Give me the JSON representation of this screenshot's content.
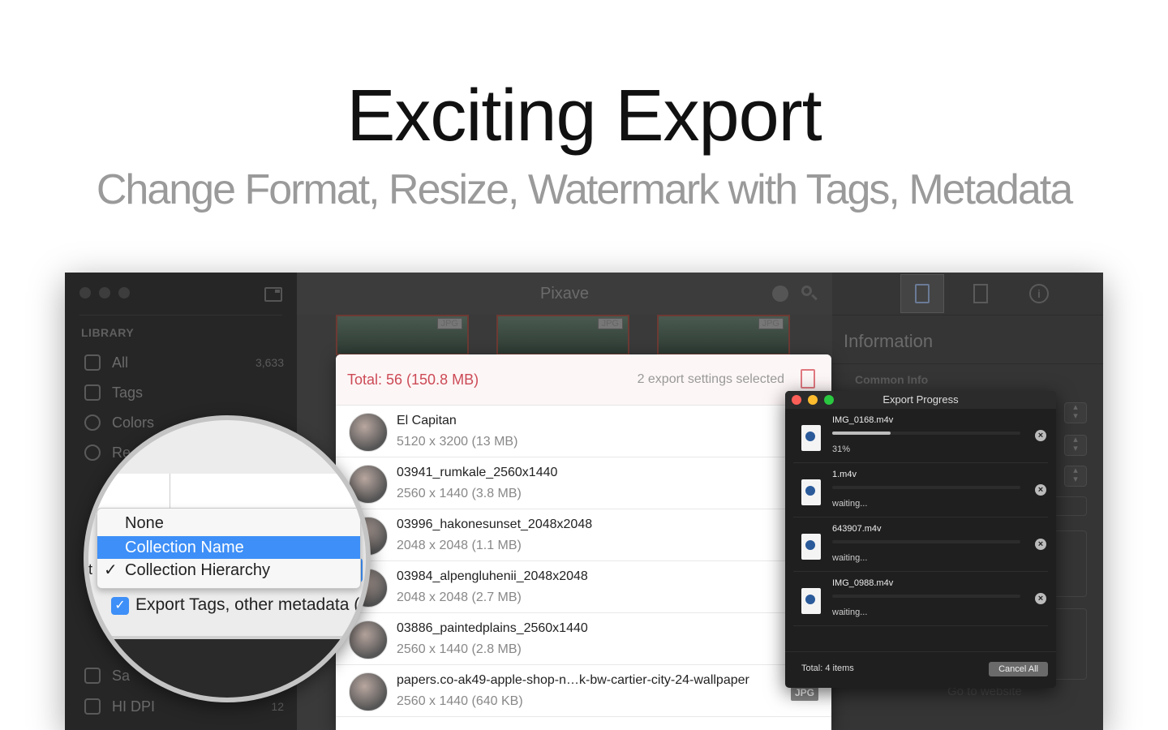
{
  "hero": {
    "title": "Exciting Export",
    "subtitle": "Change Format, Resize, Watermark with Tags, Metadata"
  },
  "window": {
    "title": "Pixave",
    "sidebar": {
      "section": "LIBRARY",
      "items": [
        {
          "label": "All",
          "count": "3,633",
          "icon": "photos-stack-icon"
        },
        {
          "label": "Tags",
          "count": "",
          "icon": "tag-icon"
        },
        {
          "label": "Colors",
          "count": "",
          "icon": "drop-icon"
        },
        {
          "label": "Re",
          "count": "",
          "icon": "clock-icon"
        },
        {
          "label": "Sa",
          "count": "",
          "icon": "box-icon"
        },
        {
          "label": "HI DPI",
          "count": "12",
          "icon": "box-icon"
        }
      ]
    },
    "inspector": {
      "title": "Information",
      "common_info": "Common Info",
      "goto": "Go to website"
    }
  },
  "export_panel": {
    "total": "Total: 56 (150.8 MB)",
    "settings": "2 export settings selected",
    "rows": [
      {
        "name": "El Capitan",
        "meta": "5120 x 3200 (13 MB)"
      },
      {
        "name": "03941_rumkale_2560x1440",
        "meta": "2560 x 1440 (3.8 MB)"
      },
      {
        "name": "03996_hakonesunset_2048x2048",
        "meta": "2048 x 2048 (1.1 MB)"
      },
      {
        "name": "03984_alpengluhenii_2048x2048",
        "meta": "2048 x 2048 (2.7 MB)"
      },
      {
        "name": "03886_paintedplains_2560x1440",
        "meta": "2560 x 1440 (2.8 MB)"
      },
      {
        "name": "papers.co-ak49-apple-shop-n…k-bw-cartier-city-24-wallpaper",
        "meta": "2560 x 1440 (640 KB)"
      }
    ],
    "badge": "JPG"
  },
  "progress": {
    "title": "Export Progress",
    "items": [
      {
        "name": "IMG_0168.m4v",
        "status": "31%",
        "progress": 0.31
      },
      {
        "name": "1.m4v",
        "status": "waiting...",
        "progress": 0
      },
      {
        "name": "643907.m4v",
        "status": "waiting...",
        "progress": 0
      },
      {
        "name": "IMG_0988.m4v",
        "status": "waiting...",
        "progress": 0
      }
    ],
    "total": "Total: 4 items",
    "cancel": "Cancel All"
  },
  "magnifier": {
    "options": [
      {
        "label": "None",
        "selected": false,
        "checked": false
      },
      {
        "label": "Collection Name",
        "selected": true,
        "checked": false
      },
      {
        "label": "Collection Hierarchy",
        "selected": false,
        "checked": true
      }
    ],
    "checkbox_label": "Export Tags, other metadata (",
    "fragment": "t"
  },
  "colors": {
    "accent": "#3e8ff7",
    "total_red": "#cc4a56"
  }
}
